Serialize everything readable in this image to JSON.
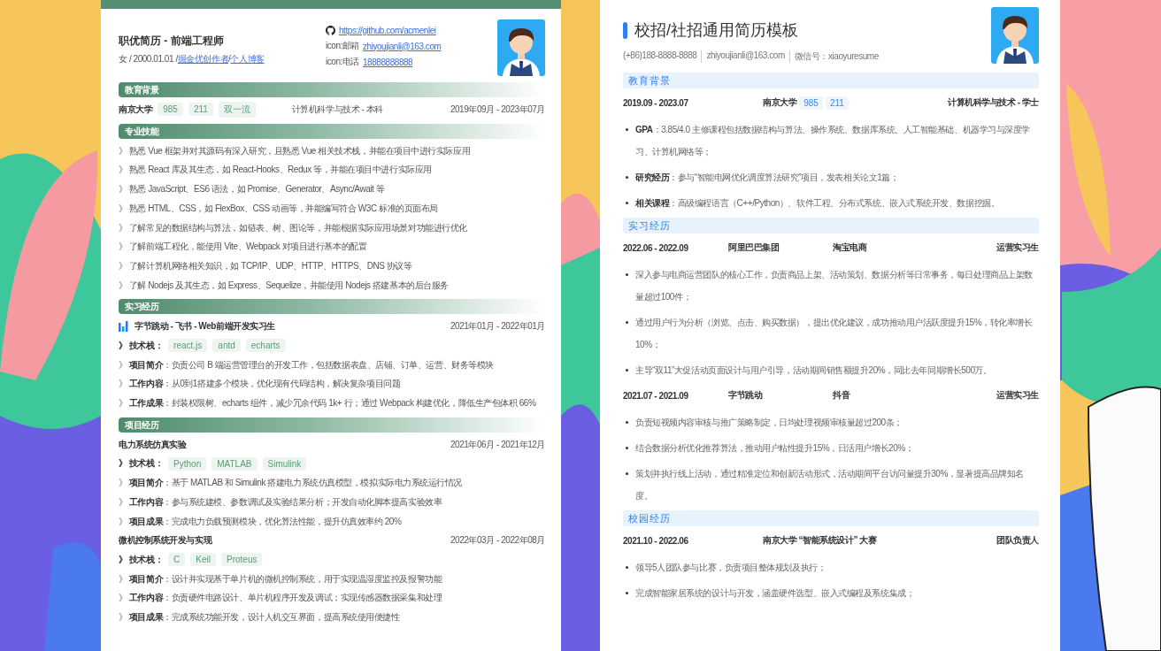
{
  "left_resume": {
    "title": "职优简历 - 前端工程师",
    "info": [
      {
        "kind": "text",
        "text": "女 / 2000.01.01 /"
      },
      {
        "kind": "link",
        "text": "掘金优创作者"
      },
      {
        "kind": "text",
        "text": "/"
      },
      {
        "kind": "link",
        "text": "个人博客"
      }
    ],
    "contacts": [
      {
        "has_icon": true,
        "value": "https://github.com/acmenlei"
      },
      {
        "has_icon": false,
        "label": "icon:邮箱",
        "value": "zhiyoujianli@163.com"
      },
      {
        "has_icon": false,
        "label": "icon:电话",
        "value": "18888888888"
      }
    ],
    "sections": [
      {
        "kind": "education",
        "title": "教育背景",
        "school": "南京大学",
        "tags": [
          "985",
          "211",
          "双一流"
        ],
        "major": "计算机科学与技术 - 本科",
        "dates": "2019年09月 - 2023年07月"
      },
      {
        "kind": "list",
        "title": "专业技能",
        "items": [
          "》 熟悉 Vue 框架并对其源码有深入研究，且熟悉 Vue 相关技术栈，并能在项目中进行实际应用",
          "》 熟悉 React 库及其生态，如 React-Hooks、Redux 等，并能在项目中进行实际应用",
          "》 熟悉 JavaScript、ES6 语法，如 Promise、Generator、Async/Await 等",
          "》 熟悉 HTML、CSS，如 FlexBox、CSS 动画等，并能编写符合 W3C 标准的页面布局",
          "》 了解常见的数据结构与算法，如链表、树、图论等，并能根据实际应用场景对功能进行优化",
          "》 了解前端工程化，能使用 Vite、Webpack 对项目进行基本的配置",
          "》 了解计算机网络相关知识，如 TCP/IP、UDP、HTTP、HTTPS、DNS 协议等",
          "》 了解 Nodejs 及其生态，如 Express、Sequelize，并能使用 Nodejs 搭建基本的后台服务"
        ]
      },
      {
        "kind": "experience",
        "title": "实习经历",
        "entries": [
          {
            "has_icon": true,
            "name": "字节跳动 - 飞书 - Web前端开发实习生",
            "dates": "2021年01月 - 2022年01月",
            "stack_label": "》 技术栈：",
            "stack": [
              "react.js",
              "antd",
              "echarts"
            ],
            "details": [
              "》 **项目简介**：负责公司 B 端运营管理台的开发工作，包括数据表盘、店铺、订单、运营、财务等模块",
              "》 **工作内容**：从0到1搭建多个模块，优化现有代码结构，解决复杂项目问题",
              "》 **工作成果**：封装权限树、echarts 组件，减少冗余代码 1k+ 行；通过 Webpack 构建优化，降低生产包体积 66%"
            ]
          }
        ]
      },
      {
        "kind": "experience",
        "title": "项目经历",
        "entries": [
          {
            "has_icon": false,
            "name": "电力系统仿真实验",
            "dates": "2021年06月 - 2021年12月",
            "stack_label": "》 技术栈：",
            "stack": [
              "Python",
              "MATLAB",
              "Simulink"
            ],
            "details": [
              "》 **项目简介**：基于 MATLAB 和 Simulink 搭建电力系统仿真模型，模拟实际电力系统运行情况",
              "》 **工作内容**：参与系统建模、参数调试及实验结果分析；开发自动化脚本提高实验效率",
              "》 **项目成果**：完成电力负载预测模块，优化算法性能，提升仿真效率约 20%"
            ]
          },
          {
            "has_icon": false,
            "name": "微机控制系统开发与实现",
            "dates": "2022年03月 - 2022年08月",
            "stack_label": "》 技术栈：",
            "stack": [
              "C",
              "Keil",
              "Proteus"
            ],
            "details": [
              "》 **项目简介**：设计并实现基于单片机的微机控制系统，用于实现温湿度监控及报警功能",
              "》 **工作内容**：负责硬件电路设计、单片机程序开发及调试；实现传感器数据采集和处理",
              "》 **项目成果**：完成系统功能开发，设计人机交互界面，提高系统使用便捷性"
            ]
          }
        ]
      }
    ]
  },
  "right_resume": {
    "title": "校招/社招通用简历模板",
    "contacts": [
      "(+86)188-8888-8888",
      "zhiyoujianli@163.com",
      "微信号：xiaoyuresume"
    ],
    "sections": [
      {
        "kind": "education",
        "title": "教育背景",
        "entries": [
          {
            "dates": "2019.09 - 2023.07",
            "school": "南京大学",
            "tags": [
              "985",
              "211"
            ],
            "degree": "计算机科学与技术 - 学士",
            "bullets": [
              "**GPA**：3.85/4.0 主修课程包括数据结构与算法、操作系统、数据库系统、人工智能基础、机器学习与深度学习、计算机网络等；",
              "**研究经历**：参与“智能电网优化调度算法研究”项目，发表相关论文1篇；",
              "**相关课程**：高级编程语言（C++/Python）、软件工程、分布式系统、嵌入式系统开发、数据挖掘。"
            ]
          }
        ]
      },
      {
        "kind": "work",
        "title": "实习经历",
        "entries": [
          {
            "dates": "2022.06 - 2022.09",
            "company": "阿里巴巴集团",
            "department": "淘宝电商",
            "role": "运营实习生",
            "bullets": [
              "深入参与电商运营团队的核心工作，负责商品上架、活动策划、数据分析等日常事务，每日处理商品上架数量超过100件；",
              "通过用户行为分析（浏览、点击、购买数据），提出优化建议，成功推动用户活跃度提升15%，转化率增长10%；",
              "主导“双11”大促活动页面设计与用户引导，活动期间销售额提升20%，同比去年同期增长500万。"
            ]
          },
          {
            "dates": "2021.07 - 2021.09",
            "company": "字节跳动",
            "department": "抖音",
            "role": "运营实习生",
            "bullets": [
              "负责短视频内容审核与推广策略制定，日均处理视频审核量超过200条；",
              "结合数据分析优化推荐算法，推动用户粘性提升15%，日活用户增长20%；",
              "策划并执行线上活动，通过精准定位和创新活动形式，活动期间平台访问量提升30%，显著提高品牌知名度。"
            ]
          }
        ]
      },
      {
        "kind": "campus",
        "title": "校园经历",
        "entries": [
          {
            "dates": "2021.10 - 2022.06",
            "event": "南京大学 “智能系统设计” 大赛",
            "role": "团队负责人",
            "bullets": [
              "领导5人团队参与比赛，负责项目整体规划及执行；",
              "完成智能家居系统的设计与开发，涵盖硬件选型、嵌入式编程及系统集成；"
            ]
          }
        ]
      }
    ]
  }
}
